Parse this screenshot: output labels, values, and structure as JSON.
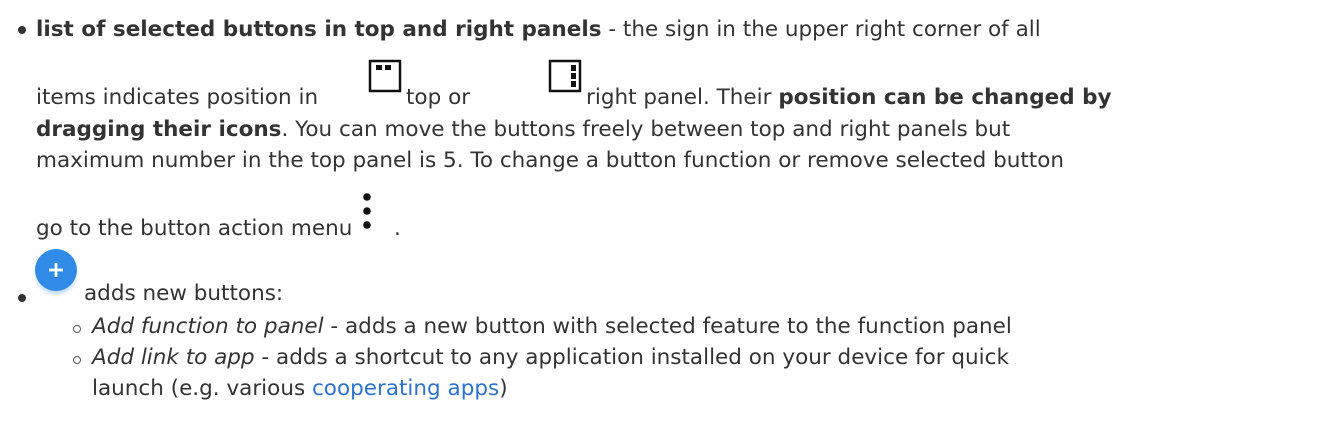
{
  "item1": {
    "bold_lead": "list of selected buttons in top and right panels",
    "line1_rest": " - the sign in the upper right corner of all",
    "line2_a": "items indicates position in",
    "line2_b": "top or",
    "line2_c": "right panel. Their",
    "line2_bold": "position can be changed by",
    "line3_bold": "dragging their icons",
    "line3_rest": ". You can move the buttons freely between top and right panels but",
    "line4": "maximum number in the top panel is 5. To change a button function or remove selected button",
    "line5_a": "go to the button action menu",
    "line5_b": "."
  },
  "item2": {
    "text": "adds new buttons:",
    "fab_color": "#2f8be6",
    "sub": [
      {
        "label": "Add function to panel",
        "desc": " - adds a new button with selected feature to the function panel"
      },
      {
        "label": "Add link to app",
        "desc": " - adds a shortcut to any application installed on your device for quick"
      }
    ],
    "sub2_line2_a": "launch (e.g. various ",
    "sub2_link": "cooperating apps",
    "sub2_line2_b": ")"
  },
  "icons": [
    "top-panel-icon",
    "right-panel-icon",
    "more-vert-icon",
    "add-fab-icon"
  ]
}
